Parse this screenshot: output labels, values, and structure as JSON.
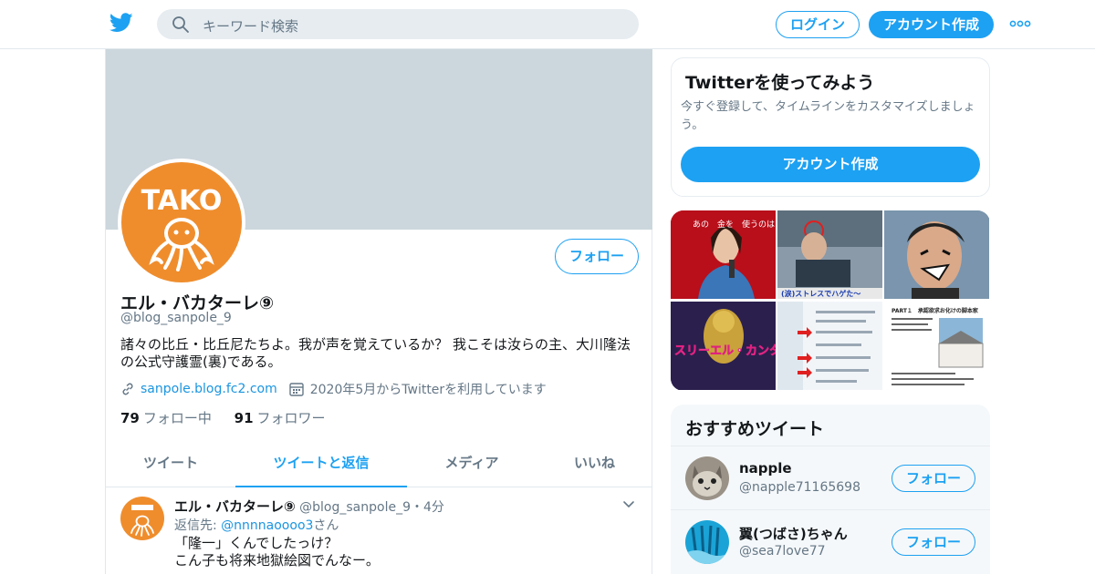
{
  "header": {
    "search_placeholder": "キーワード検索",
    "login_label": "ログイン",
    "signup_label": "アカウント作成"
  },
  "profile": {
    "name": "エル・バカターレ⑨",
    "handle": "@blog_sanpole_9",
    "follow_label": "フォロー",
    "bio_line1": "諸々の比丘・比丘尼たちよ。我が声を覚えているか？ 我こそは汝らの主、大川隆法",
    "bio_line2": "の公式守護霊(裏)である。",
    "website": "sanpole.blog.fc2.com",
    "joined": "2020年5月からTwitterを利用しています",
    "following_count": "79",
    "following_label": "フォロー中",
    "followers_count": "91",
    "followers_label": "フォロワー",
    "avatar_text": "TAKO"
  },
  "tabs": [
    {
      "label": "ツイート",
      "active": false
    },
    {
      "label": "ツイートと返信",
      "active": true
    },
    {
      "label": "メディア",
      "active": false
    },
    {
      "label": "いいね",
      "active": false
    }
  ],
  "tweet": {
    "name": "エル・バカターレ⑨",
    "handle": "@blog_sanpole_9",
    "time": "・4分",
    "reply_prefix": "返信先: ",
    "reply_to": "@nnnnaoooo3",
    "reply_suffix": "さん",
    "line1": "「隆一」くんでしたっけ？",
    "line2": "こん子も将来地獄絵図でんなー。"
  },
  "signup_card": {
    "title": "Twitterを使ってみよう",
    "desc": "今すぐ登録して、タイムラインをカスタマイズしましょう。",
    "button": "アカウント作成"
  },
  "media_grid": {
    "cell1_text": "あの　金を　使うのは　あなたね",
    "cell2_caption": "(涙)ストレスでハゲた〜",
    "cell5_text": "スリーエル・カンターレ",
    "cell6_title": "PART１　承認欲求お化けの脚本家"
  },
  "recommend": {
    "title": "おすすめツイート",
    "users": [
      {
        "name": "napple",
        "handle": "@napple71165698",
        "button": "フォロー"
      },
      {
        "name": "翼(つばさ)ちゃん",
        "handle": "@sea7love77",
        "button": "フォロー"
      }
    ]
  },
  "colors": {
    "accent": "#1da1f2",
    "banner": "#ccd6dd",
    "avatar_bg": "#ef8d2d"
  }
}
